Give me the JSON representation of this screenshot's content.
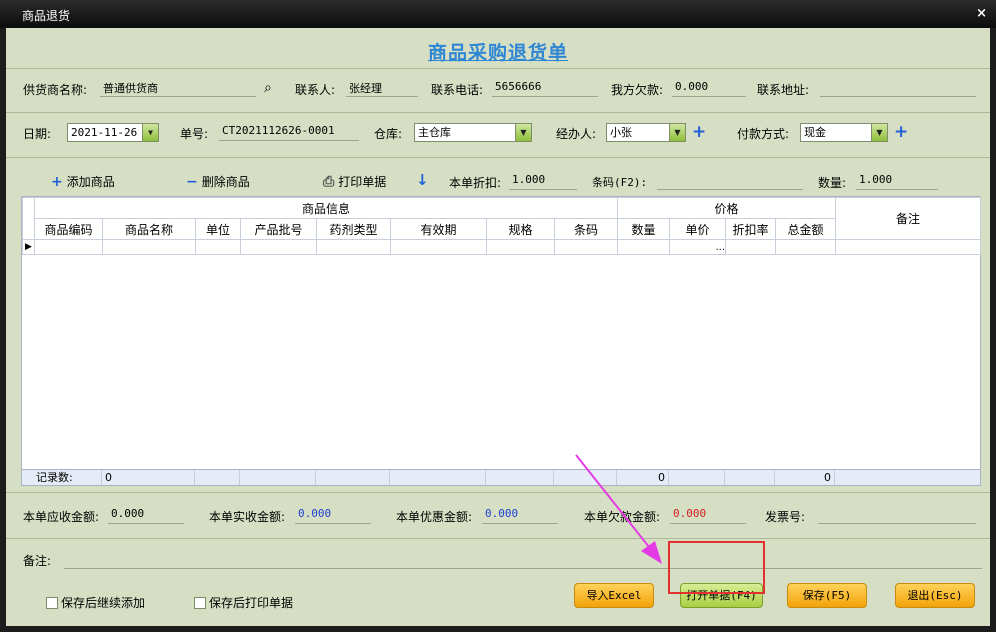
{
  "window": {
    "title": "商品退货",
    "close": "×"
  },
  "heading": "商品采购退货单",
  "row1": {
    "supplier_label": "供货商名称:",
    "supplier": "普通供货商",
    "contact_label": "联系人:",
    "contact": "张经理",
    "phone_label": "联系电话:",
    "phone": "5656666",
    "debt_label": "我方欠款:",
    "debt": "0.000",
    "address_label": "联系地址:",
    "address": ""
  },
  "row2": {
    "date_label": "日期:",
    "date": "2021-11-26",
    "no_label": "单号:",
    "no": "CT2021112626-0001",
    "warehouse_label": "仓库:",
    "warehouse": "主仓库",
    "handler_label": "经办人:",
    "handler": "小张",
    "payment_label": "付款方式:",
    "payment": "现金"
  },
  "toolbar": {
    "add": "添加商品",
    "delete": "删除商品",
    "print": "打印单据",
    "discount_label": "本单折扣:",
    "discount": "1.000",
    "barcode_label": "条码(F2):",
    "barcode": "",
    "qty_label": "数量:",
    "qty": "1.000"
  },
  "grid": {
    "group_info": "商品信息",
    "group_price": "价格",
    "remark": "备注",
    "columns": [
      "商品编码",
      "商品名称",
      "单位",
      "产品批号",
      "药剂类型",
      "有效期",
      "规格",
      "条码",
      "数量",
      "单价",
      "折扣率",
      "总金额"
    ],
    "row_marker": "▶",
    "ellipsis": "...",
    "summary": {
      "label": "记录数:",
      "count": "0",
      "qty_total": "0",
      "amount_total": "0"
    }
  },
  "totals": {
    "receivable_label": "本单应收金额:",
    "receivable": "0.000",
    "received_label": "本单实收金额:",
    "received": "0.000",
    "discount_label": "本单优惠金额:",
    "discount": "0.000",
    "owed_label": "本单欠款金额:",
    "owed": "0.000",
    "invoice_label": "发票号:",
    "invoice": ""
  },
  "remark_label": "备注:",
  "checks": {
    "continue": "保存后继续添加",
    "print": "保存后打印单据"
  },
  "buttons": {
    "import": "导入Excel",
    "open": "打开单据(F4)",
    "save": "保存(F5)",
    "exit": "退出(Esc)"
  }
}
